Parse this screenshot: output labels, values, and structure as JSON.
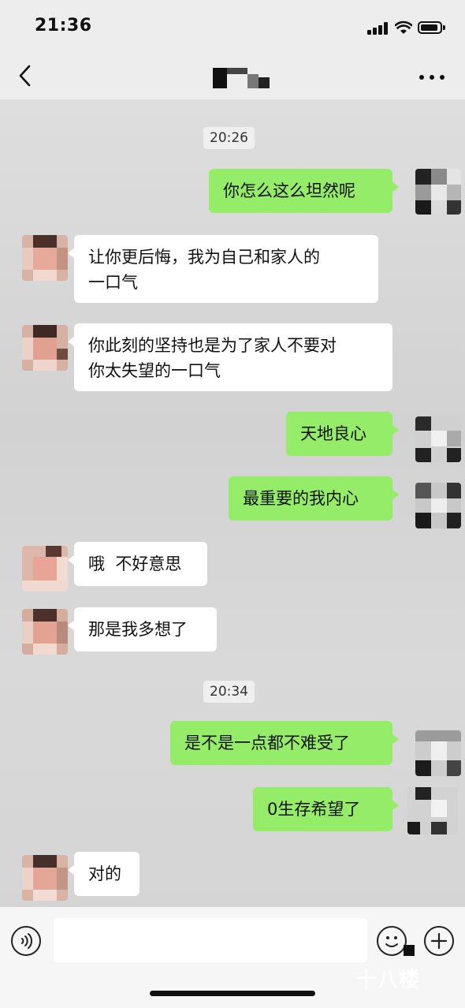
{
  "status_bar": {
    "time": "21:36"
  },
  "header": {
    "back_icon": "chevron-left-icon",
    "more_icon": "ellipsis-icon"
  },
  "messages": [
    {
      "type": "time",
      "text": "20:26"
    },
    {
      "type": "sent",
      "text": "你怎么这么坦然呢"
    },
    {
      "type": "received",
      "lines": [
        "让你更后悔，我为自己和家人的",
        "一口气"
      ]
    },
    {
      "type": "received",
      "lines": [
        "你此刻的坚持也是为了家人不要对",
        "你太失望的一口气"
      ]
    },
    {
      "type": "sent",
      "text": "天地良心"
    },
    {
      "type": "sent",
      "text": "最重要的我内心"
    },
    {
      "type": "received",
      "text": "哦  不好意思"
    },
    {
      "type": "received",
      "text": "那是我多想了"
    },
    {
      "type": "time",
      "text": "20:34"
    },
    {
      "type": "sent",
      "text": "是不是一点都不难受了"
    },
    {
      "type": "sent",
      "text": "0生存希望了"
    },
    {
      "type": "received",
      "text": "对的"
    }
  ],
  "input_bar": {
    "voice_icon": "voice-icon",
    "emoji_icon": "emoji-icon",
    "plus_icon": "plus-icon"
  },
  "watermark": "十八楼"
}
